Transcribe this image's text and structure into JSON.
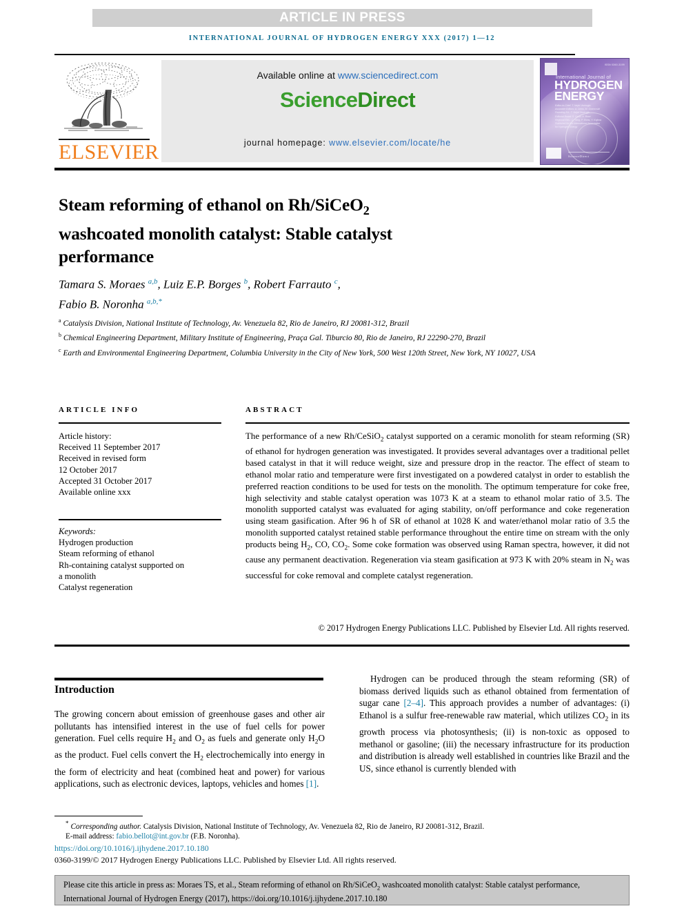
{
  "banner": {
    "article_in_press": "ARTICLE IN PRESS"
  },
  "journal_running_head": "INTERNATIONAL JOURNAL OF HYDROGEN ENERGY XXX (2017) 1—12",
  "masthead": {
    "publisher_name": "ELSEVIER",
    "available_online_prefix": "Available online at ",
    "sciencedirect_url": "www.sciencedirect.com",
    "sciencedirect_logo_part1": "Science",
    "sciencedirect_logo_part2": "Direct",
    "journal_homepage_label": "journal homepage: ",
    "journal_homepage_url": "www.elsevier.com/locate/he",
    "cover": {
      "issn_text": "ISSN 0360-3199",
      "line_small": "International Journal of",
      "line_big_1": "HYDROGEN",
      "line_big_2": "ENERGY",
      "editors_block": [
        "Editor-in-Chief: T. Nejat Veziroglu",
        "Associate Editors: A. Dicks, M. Granovskii",
        "Founding Ed.: T. Nejat Veziroglu",
        "Editorial Board: S. Dunn, A. Bose",
        "Regional Eds.: C. Yang, P. Ekins, Y. Kojima",
        "Published for the International Association",
        "for Hydrogen Energy"
      ],
      "footer_text": "ScienceDirect"
    }
  },
  "article": {
    "title_line1": "Steam reforming of ethanol on Rh/SiCeO",
    "title_sub": "2",
    "title_line2": "washcoated monolith catalyst: Stable catalyst",
    "title_line3": "performance",
    "authors_line1_name1": "Tamara S. Moraes ",
    "authors_line1_sup1": "a,b",
    "authors_line1_name2": ", Luiz E.P. Borges ",
    "authors_line1_sup2": "b",
    "authors_line1_name3": ", Robert Farrauto ",
    "authors_line1_sup3": "c",
    "authors_line1_tail": ",",
    "authors_line2_name": "Fabio B. Noronha ",
    "authors_line2_sup": "a,b,*",
    "affiliations": [
      {
        "marker": "a",
        "text": "Catalysis Division, National Institute of Technology, Av. Venezuela 82, Rio de Janeiro, RJ 20081-312, Brazil"
      },
      {
        "marker": "b",
        "text": "Chemical Engineering Department, Military Institute of Engineering, Praça Gal. Tiburcio 80, Rio de Janeiro, RJ 22290-270, Brazil"
      },
      {
        "marker": "c",
        "text": "Earth and Environmental Engineering Department, Columbia University in the City of New York, 500 West 120th Street, New York, NY 10027, USA"
      }
    ]
  },
  "article_info": {
    "heading": "ARTICLE INFO",
    "history_label": "Article history:",
    "history": [
      "Received 11 September 2017",
      "Received in revised form",
      "12 October 2017",
      "Accepted 31 October 2017",
      "Available online xxx"
    ],
    "keywords_label": "Keywords:",
    "keywords": [
      "Hydrogen production",
      "Steam reforming of ethanol",
      "Rh-containing catalyst supported on",
      "a monolith",
      "Catalyst regeneration"
    ]
  },
  "abstract": {
    "heading": "ABSTRACT",
    "part1": "The performance of a new Rh/CeSiO",
    "sub1": "2",
    "part2": " catalyst supported on a ceramic monolith for steam reforming (SR) of ethanol for hydrogen generation was investigated. It provides several advantages over a traditional pellet based catalyst in that it will reduce weight, size and pressure drop in the reactor. The effect of steam to ethanol molar ratio and temperature were first investigated on a powdered catalyst in order to establish the preferred reaction conditions to be used for tests on the monolith. The optimum temperature for coke free, high selectivity and stable catalyst operation was 1073 K at a steam to ethanol molar ratio of 3.5. The monolith supported catalyst was evaluated for aging stability, on/off performance and coke regeneration using steam gasification. After 96 h of SR of ethanol at 1028 K and water/ethanol molar ratio of 3.5 the monolith supported catalyst retained stable performance throughout the entire time on stream with the only products being H",
    "sub2": "2",
    "part3": ", CO, CO",
    "sub3": "2",
    "part4": ". Some coke formation was observed using Raman spectra, however, it did not cause any permanent deactivation. Regeneration via steam gasification at 973 K with 20% steam in N",
    "sub4": "2",
    "part5": " was successful for coke removal and complete catalyst regeneration.",
    "copyright": "© 2017 Hydrogen Energy Publications LLC. Published by Elsevier Ltd. All rights reserved."
  },
  "body": {
    "intro_heading": "Introduction",
    "left_part1": "The growing concern about emission of greenhouse gases and other air pollutants has intensified interest in the use of fuel cells for power generation. Fuel cells require H",
    "left_sub1": "2",
    "left_part2": " and O",
    "left_sub2": "2",
    "left_part3": " as fuels and generate only H",
    "left_sub3": "2",
    "left_part4": "O as the product. Fuel cells convert the H",
    "left_sub4": "2",
    "left_part5": " electrochemically into energy in the form of electricity and heat (combined heat and power) for various applications, such as electronic devices, laptops, vehicles and homes ",
    "left_ref": "[1]",
    "left_part6": ".",
    "right_part1": "Hydrogen can be produced through the steam reforming (SR) of biomass derived liquids such as ethanol obtained from fermentation of sugar cane ",
    "right_ref": "[2–4]",
    "right_part2": ". This approach provides a number of advantages: (i) Ethanol is a sulfur free-renewable raw material, which utilizes CO",
    "right_sub1": "2",
    "right_part3": " in its growth process via photosynthesis; (ii) is non-toxic as opposed to methanol or gasoline; (iii) the necessary infrastructure for its production and distribution is already well established in countries like Brazil and the US, since ethanol is currently blended with"
  },
  "footnote": {
    "star": "*",
    "corresponding_label": "Corresponding author.",
    "corresponding_address": " Catalysis Division, National Institute of Technology, Av. Venezuela 82, Rio de Janeiro, RJ 20081-312, Brazil.",
    "email_label": "E-mail address: ",
    "email": "fabio.bellot@int.gov.br",
    "email_owner": " (F.B. Noronha).",
    "doi": "https://doi.org/10.1016/j.ijhydene.2017.10.180",
    "issn_copyright": "0360-3199/© 2017 Hydrogen Energy Publications LLC. Published by Elsevier Ltd. All rights reserved."
  },
  "cite_box": {
    "part1": "Please cite this article in press as: Moraes TS, et al., Steam reforming of ethanol on Rh/SiCeO",
    "sub1": "2",
    "part2": " washcoated monolith catalyst: Stable catalyst performance, International Journal of Hydrogen Energy (2017), https://doi.org/10.1016/j.ijhydene.2017.10.180"
  },
  "colors": {
    "link_blue": "#2a6ebb",
    "journal_teal": "#0b6b8f",
    "elsevier_orange": "#f07d1a",
    "sciencedirect_green": "#3a9e2e",
    "banner_gray": "#cfcfcf",
    "cite_box_gray": "#c8c8c8"
  }
}
